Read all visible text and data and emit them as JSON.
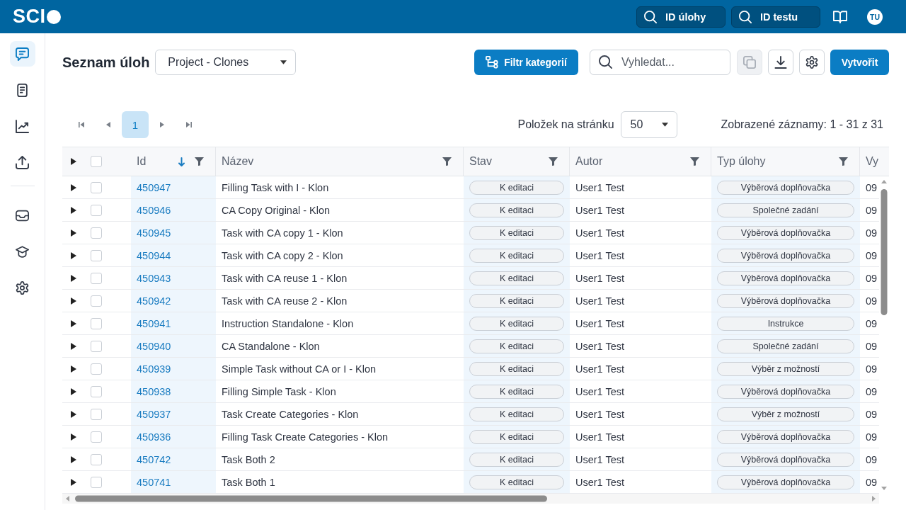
{
  "top_bar": {
    "logo": "SCI",
    "search_buttons": [
      {
        "label": "ID úlohy"
      },
      {
        "label": "ID testu"
      }
    ],
    "avatar": "TU"
  },
  "sidebar": {
    "sections": [
      {
        "items": [
          {
            "selected": true
          },
          {
            "selected": false
          },
          {
            "selected": false
          },
          {
            "selected": false
          }
        ]
      },
      {
        "items": [
          {
            "selected": false
          },
          {
            "selected": false
          },
          {
            "selected": false
          }
        ]
      }
    ]
  },
  "toolbar": {
    "title": "Seznam úloh",
    "project_select": {
      "value": "Project - Clones"
    },
    "filter_button": "Filtr kategorií",
    "search": {
      "placeholder": "Vyhledat..."
    },
    "icon_buttons": [
      {
        "disabled": true
      },
      {
        "disabled": false
      },
      {
        "disabled": false
      }
    ],
    "create_button": "Vytvořit"
  },
  "pagination": {
    "pages": [
      {
        "label": "1",
        "selected": true
      }
    ],
    "per_page_label": "Položek na stránku",
    "per_page_value": "50",
    "summary": "Zobrazené záznamy: 1 - 31 z 31"
  },
  "table": {
    "expand_all": {
      "expanded": false
    },
    "select_all": {
      "checked": false
    },
    "columns": [
      {
        "label": "Id",
        "kind": "link",
        "sorted": true,
        "filter": true,
        "highlighted": true
      },
      {
        "label": "Název",
        "kind": "text",
        "sorted": false,
        "filter": true,
        "highlighted": false
      },
      {
        "label": "Stav",
        "kind": "pill",
        "sorted": false,
        "filter": true,
        "highlighted": true
      },
      {
        "label": "Autor",
        "kind": "text",
        "sorted": false,
        "filter": true,
        "highlighted": false
      },
      {
        "label": "Typ úlohy",
        "kind": "pill",
        "sorted": false,
        "filter": true,
        "highlighted": true
      },
      {
        "label": "Vy",
        "kind": "text",
        "sorted": false,
        "filter": false,
        "highlighted": false
      }
    ],
    "rows": [
      {
        "expanded": false,
        "checked": false,
        "cells": [
          "450947",
          "Filling Task with I - Klon",
          "K editaci",
          "User1 Test",
          "Výběrová doplňovačka",
          "09"
        ]
      },
      {
        "expanded": false,
        "checked": false,
        "cells": [
          "450946",
          "CA Copy Original - Klon",
          "K editaci",
          "User1 Test",
          "Společné zadání",
          "09"
        ]
      },
      {
        "expanded": false,
        "checked": false,
        "cells": [
          "450945",
          "Task with CA copy 1 - Klon",
          "K editaci",
          "User1 Test",
          "Výběrová doplňovačka",
          "09"
        ]
      },
      {
        "expanded": false,
        "checked": false,
        "cells": [
          "450944",
          "Task with CA copy 2 - Klon",
          "K editaci",
          "User1 Test",
          "Výběrová doplňovačka",
          "09"
        ]
      },
      {
        "expanded": false,
        "checked": false,
        "cells": [
          "450943",
          "Task with CA reuse 1 - Klon",
          "K editaci",
          "User1 Test",
          "Výběrová doplňovačka",
          "09"
        ]
      },
      {
        "expanded": false,
        "checked": false,
        "cells": [
          "450942",
          "Task with CA reuse 2 - Klon",
          "K editaci",
          "User1 Test",
          "Výběrová doplňovačka",
          "09"
        ]
      },
      {
        "expanded": false,
        "checked": false,
        "cells": [
          "450941",
          "Instruction Standalone - Klon",
          "K editaci",
          "User1 Test",
          "Instrukce",
          "09"
        ]
      },
      {
        "expanded": false,
        "checked": false,
        "cells": [
          "450940",
          "CA Standalone - Klon",
          "K editaci",
          "User1 Test",
          "Společné zadání",
          "09"
        ]
      },
      {
        "expanded": false,
        "checked": false,
        "cells": [
          "450939",
          "Simple Task without CA or I - Klon",
          "K editaci",
          "User1 Test",
          "Výběr z možností",
          "09"
        ]
      },
      {
        "expanded": false,
        "checked": false,
        "cells": [
          "450938",
          "Filling Simple Task - Klon",
          "K editaci",
          "User1 Test",
          "Výběrová doplňovačka",
          "09"
        ]
      },
      {
        "expanded": false,
        "checked": false,
        "cells": [
          "450937",
          "Task Create Categories - Klon",
          "K editaci",
          "User1 Test",
          "Výběr z možností",
          "09"
        ]
      },
      {
        "expanded": false,
        "checked": false,
        "cells": [
          "450936",
          "Filling Task Create Categories - Klon",
          "K editaci",
          "User1 Test",
          "Výběrová doplňovačka",
          "09"
        ]
      },
      {
        "expanded": false,
        "checked": false,
        "cells": [
          "450742",
          "Task Both 2",
          "K editaci",
          "User1 Test",
          "Výběrová doplňovačka",
          "09"
        ]
      },
      {
        "expanded": false,
        "checked": false,
        "cells": [
          "450741",
          "Task Both 1",
          "K editaci",
          "User1 Test",
          "Výběrová doplňovačka",
          "09"
        ]
      }
    ]
  }
}
